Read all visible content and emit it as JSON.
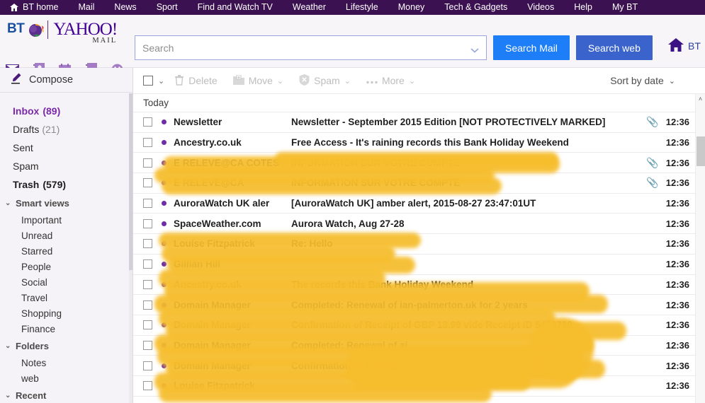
{
  "bt_nav": {
    "items": [
      {
        "label": "BT home",
        "icon": "home-icon"
      },
      {
        "label": "Mail"
      },
      {
        "label": "News"
      },
      {
        "label": "Sport"
      },
      {
        "label": "Find and Watch TV"
      },
      {
        "label": "Weather"
      },
      {
        "label": "Lifestyle"
      },
      {
        "label": "Money"
      },
      {
        "label": "Tech & Gadgets"
      },
      {
        "label": "Videos"
      },
      {
        "label": "Help"
      },
      {
        "label": "My BT"
      }
    ]
  },
  "header": {
    "bt_logo": "BT",
    "yahoo_logo": "YAHOO!",
    "yahoo_sub": "MAIL",
    "app_icons": [
      "mail-icon",
      "contacts-icon",
      "calendar-icon",
      "notepad-icon",
      "smiley-icon"
    ],
    "search": {
      "placeholder": "Search",
      "value": "",
      "search_mail_label": "Search Mail",
      "search_web_label": "Search web"
    },
    "bt_home_right": "BT"
  },
  "sidebar": {
    "compose_label": "Compose",
    "folders": [
      {
        "label": "Inbox",
        "count": "(89)",
        "state": "active"
      },
      {
        "label": "Drafts",
        "count": "(21)",
        "state": "normal"
      },
      {
        "label": "Sent",
        "count": "",
        "state": "normal"
      },
      {
        "label": "Spam",
        "count": "",
        "state": "normal"
      },
      {
        "label": "Trash",
        "count": "(579)",
        "state": "bold"
      }
    ],
    "groups": [
      {
        "label": "Smart views",
        "caret": "⌄",
        "items": [
          "Important",
          "Unread",
          "Starred",
          "People",
          "Social",
          "Travel",
          "Shopping",
          "Finance"
        ]
      },
      {
        "label": "Folders",
        "caret": "⌄",
        "items": [
          "Notes",
          "web"
        ]
      },
      {
        "label": "Recent",
        "caret": "⌄",
        "items": []
      }
    ]
  },
  "toolbar": {
    "select_all_caret": "⌄",
    "buttons": [
      {
        "label": "Delete",
        "icon": "trash-icon",
        "caret": ""
      },
      {
        "label": "Move",
        "icon": "move-folder-icon",
        "caret": "⌄"
      },
      {
        "label": "Spam",
        "icon": "spam-shield-icon",
        "caret": "⌄"
      },
      {
        "label": "More",
        "icon": "more-dots-icon",
        "caret": "⌄"
      }
    ],
    "sort_label": "Sort by date",
    "sort_caret": "⌄"
  },
  "list": {
    "section_label": "Today",
    "messages": [
      {
        "sender": "Newsletter",
        "subject": "Newsletter - September 2015 Edition [NOT PROTECTIVELY MARKED]",
        "time": "12:36",
        "unread": true,
        "attachment": true,
        "redacted": false
      },
      {
        "sender": "Ancestry.co.uk",
        "subject": "Free Access - It's raining records this Bank Holiday Weekend",
        "time": "12:36",
        "unread": true,
        "attachment": false,
        "redacted": true
      },
      {
        "sender": "E RELEVE@CA COTES",
        "subject": "INFORMATION SUR VOTRE COMPTE",
        "time": "12:36",
        "unread": true,
        "attachment": true,
        "redacted": true
      },
      {
        "sender": "E RELEVE@CA",
        "subject": "INFORMATION SUR VOTRE COMPTE",
        "time": "12:36",
        "unread": true,
        "attachment": true,
        "redacted": true
      },
      {
        "sender": "AuroraWatch UK aler",
        "subject": "[AuroraWatch UK] amber alert, 2015-08-27 23:47:01UT",
        "time": "12:36",
        "unread": true,
        "attachment": false,
        "redacted": false
      },
      {
        "sender": "SpaceWeather.com",
        "subject": "Aurora Watch, Aug 27-28",
        "time": "12:36",
        "unread": true,
        "attachment": false,
        "redacted": true
      },
      {
        "sender": "Louise Fitzpatrick",
        "subject": "Re: Hello",
        "time": "12:36",
        "unread": true,
        "attachment": false,
        "redacted": true
      },
      {
        "sender": "Gillian Hill",
        "subject": "",
        "time": "12:36",
        "unread": true,
        "attachment": false,
        "redacted": true
      },
      {
        "sender": "Ancestry.co.uk",
        "subject": "The records this Bank Holiday Weekend",
        "time": "12:36",
        "unread": true,
        "attachment": false,
        "redacted": true
      },
      {
        "sender": "Domain Manager",
        "subject": "Completed: Renewal of ian-palmerton.uk for 2 years",
        "time": "12:36",
        "unread": true,
        "attachment": false,
        "redacted": true
      },
      {
        "sender": "Domain Manager",
        "subject": "Confirmation of Receipt of GBP 18.99 vide Receipt ID 5453730",
        "time": "12:36",
        "unread": true,
        "attachment": false,
        "redacted": true
      },
      {
        "sender": "Domain Manager",
        "subject": "Completed: Renewal of ai",
        "time": "12:36",
        "unread": true,
        "attachment": false,
        "redacted": true
      },
      {
        "sender": "Domain Manager",
        "subject": "Confirmation of Receip",
        "time": "12:36",
        "unread": true,
        "attachment": false,
        "redacted": true
      },
      {
        "sender": "Louise Fitzpatrick",
        "subject": "",
        "time": "12:36",
        "unread": true,
        "attachment": false,
        "redacted": true
      }
    ],
    "scroll_up_caret": "˄"
  },
  "colors": {
    "bt_purple": "#3b1152",
    "accent_purple": "#6f2da8",
    "search_mail_blue": "#1d7ef7",
    "search_web_blue": "#3a64cc",
    "redaction_yellow": "#f6bd2c"
  }
}
